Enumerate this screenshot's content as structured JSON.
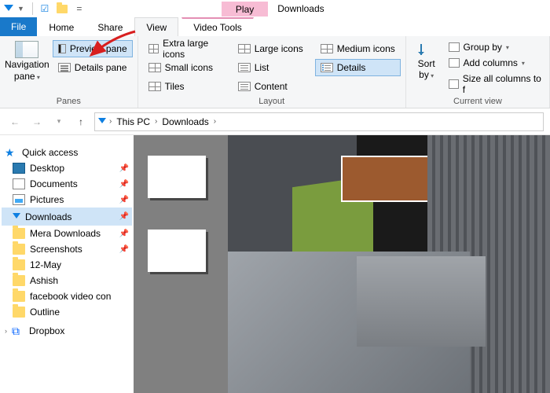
{
  "title": "Downloads",
  "contextual_tab": {
    "header": "Play",
    "name": "Video Tools"
  },
  "tabs": {
    "file": "File",
    "home": "Home",
    "share": "Share",
    "view": "View"
  },
  "ribbon": {
    "panes": {
      "group_label": "Panes",
      "navigation": "Navigation",
      "navigation2": "pane",
      "preview": "Preview pane",
      "details": "Details pane"
    },
    "layout": {
      "group_label": "Layout",
      "extra_large": "Extra large icons",
      "large": "Large icons",
      "medium": "Medium icons",
      "small": "Small icons",
      "list": "List",
      "details": "Details",
      "tiles": "Tiles",
      "content": "Content"
    },
    "sort": {
      "label1": "Sort",
      "label2": "by"
    },
    "current_view": {
      "group_label": "Current view",
      "group_by": "Group by",
      "add_columns": "Add columns",
      "size_all": "Size all columns to f"
    }
  },
  "breadcrumb": {
    "root": "This PC",
    "cur": "Downloads"
  },
  "tree": {
    "quick_access": "Quick access",
    "items": [
      {
        "label": "Desktop",
        "pinned": true
      },
      {
        "label": "Documents",
        "pinned": true
      },
      {
        "label": "Pictures",
        "pinned": true
      },
      {
        "label": "Downloads",
        "pinned": true
      },
      {
        "label": "Mera Downloads",
        "pinned": true
      },
      {
        "label": "Screenshots",
        "pinned": true
      },
      {
        "label": "12-May",
        "pinned": false
      },
      {
        "label": "Ashish",
        "pinned": false
      },
      {
        "label": "facebook video con",
        "pinned": false
      },
      {
        "label": "Outline",
        "pinned": false
      }
    ],
    "dropbox": "Dropbox"
  }
}
